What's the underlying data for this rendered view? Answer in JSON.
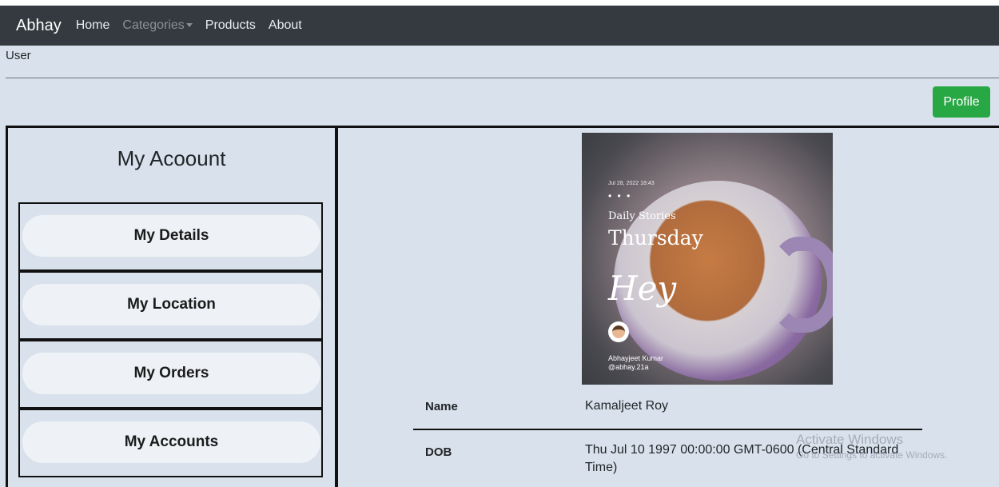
{
  "navbar": {
    "brand": "Abhay",
    "links": [
      "Home",
      "Categories",
      "Products",
      "About"
    ]
  },
  "user_label": "User",
  "profile_button": "Profile",
  "sidebar": {
    "title": "My Acoount",
    "items": [
      "My Details",
      "My Location",
      "My Orders",
      "My Accounts"
    ]
  },
  "photo": {
    "date": "Jul 28, 2022 18:43",
    "dots": "• • •",
    "subtitle": "Daily Stories",
    "day": "Thursday",
    "greeting": "Hey",
    "author": "Abhayjeet Kumar",
    "handle": "@abhay.21a"
  },
  "details": {
    "name_label": "Name",
    "name_value": "Kamaljeet Roy",
    "dob_label": "DOB",
    "dob_value": "Thu Jul 10 1997 00:00:00 GMT-0600 (Central Standard Time)"
  },
  "watermark": {
    "line1": "Activate Windows",
    "line2": "Go to Settings to activate Windows."
  },
  "colors": {
    "navbar": "#343a40",
    "page_bg": "#d9e2ec",
    "profile_button": "#28a745"
  }
}
